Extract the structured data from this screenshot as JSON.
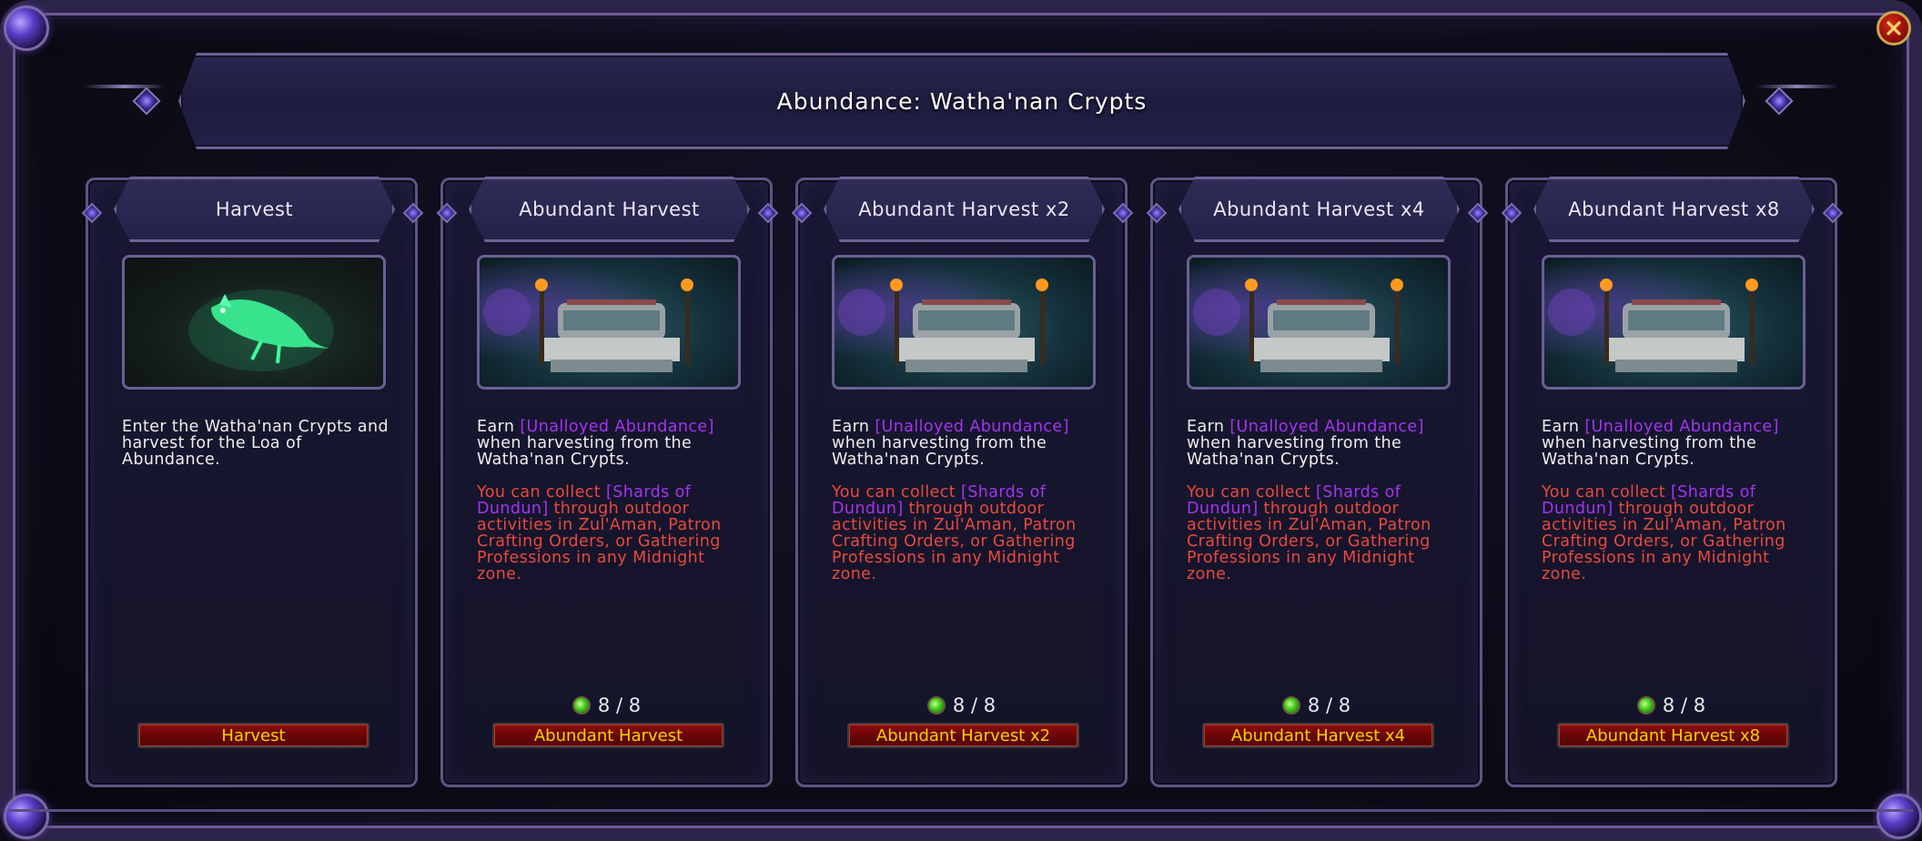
{
  "window": {
    "title": "Abundance: Watha'nan Crypts",
    "close_icon": "close-icon"
  },
  "colors": {
    "accent_purple": "#a335ee",
    "warning_red": "#e84a3c",
    "button_text": "#f5d100",
    "button_bg": "#6b0707",
    "frame": "#2c2448"
  },
  "cards": [
    {
      "title": "Harvest",
      "image": "green-spirit-creature",
      "desc_lines": [
        "Enter the Watha'nan Crypts and",
        "harvest for the Loa of",
        "Abundance."
      ],
      "button": "Harvest"
    },
    {
      "title": "Abundant Harvest",
      "image": "crypt-altar",
      "earn_prefix": "Earn ",
      "earn_link": "[Unalloyed Abundance]",
      "earn_rest_1": "when harvesting from the",
      "earn_rest_2": "Watha'nan Crypts.",
      "note_prefix": "You can collect ",
      "note_link_1": "[Shards of",
      "note_link_2": "Dundun]",
      "note_rest_1": " through outdoor",
      "note_rest_2": "activities in Zul'Aman, Patron",
      "note_rest_3": "Crafting Orders, or Gathering",
      "note_rest_4": "Professions in any Midnight",
      "note_rest_5": "zone.",
      "count": "8 / 8",
      "button": "Abundant Harvest"
    },
    {
      "title": "Abundant Harvest x2",
      "image": "crypt-altar",
      "earn_prefix": "Earn ",
      "earn_link": "[Unalloyed Abundance]",
      "earn_rest_1": "when harvesting from the",
      "earn_rest_2": "Watha'nan Crypts.",
      "note_prefix": "You can collect ",
      "note_link_1": "[Shards of",
      "note_link_2": "Dundun]",
      "note_rest_1": " through outdoor",
      "note_rest_2": "activities in Zul'Aman, Patron",
      "note_rest_3": "Crafting Orders, or Gathering",
      "note_rest_4": "Professions in any Midnight",
      "note_rest_5": "zone.",
      "count": "8 / 8",
      "button": "Abundant Harvest x2"
    },
    {
      "title": "Abundant Harvest x4",
      "image": "crypt-altar",
      "earn_prefix": "Earn ",
      "earn_link": "[Unalloyed Abundance]",
      "earn_rest_1": "when harvesting from the",
      "earn_rest_2": "Watha'nan Crypts.",
      "note_prefix": "You can collect ",
      "note_link_1": "[Shards of",
      "note_link_2": "Dundun]",
      "note_rest_1": " through outdoor",
      "note_rest_2": "activities in Zul'Aman, Patron",
      "note_rest_3": "Crafting Orders, or Gathering",
      "note_rest_4": "Professions in any Midnight",
      "note_rest_5": "zone.",
      "count": "8 / 8",
      "button": "Abundant Harvest x4"
    },
    {
      "title": "Abundant Harvest x8",
      "image": "crypt-altar",
      "earn_prefix": "Earn ",
      "earn_link": "[Unalloyed Abundance]",
      "earn_rest_1": "when harvesting from the",
      "earn_rest_2": "Watha'nan Crypts.",
      "note_prefix": "You can collect ",
      "note_link_1": "[Shards of",
      "note_link_2": "Dundun]",
      "note_rest_1": " through outdoor",
      "note_rest_2": "activities in Zul'Aman, Patron",
      "note_rest_3": "Crafting Orders, or Gathering",
      "note_rest_4": "Professions in any Midnight",
      "note_rest_5": "zone.",
      "count": "8 / 8",
      "button": "Abundant Harvest x8"
    }
  ]
}
